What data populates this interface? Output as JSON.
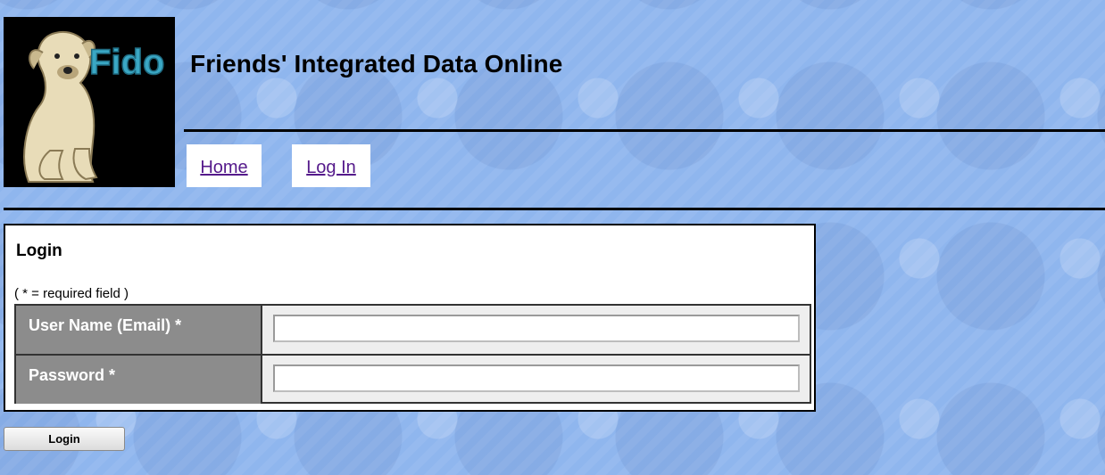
{
  "header": {
    "logo_text": "Fido",
    "site_title": "Friends' Integrated Data Online"
  },
  "nav": {
    "home_label": "Home",
    "login_label": "Log In"
  },
  "login_form": {
    "heading": "Login",
    "required_note": "( * = required field )",
    "username_label": "User Name (Email) *",
    "username_value": "",
    "password_label": "Password *",
    "password_value": "",
    "submit_label": "Login"
  },
  "colors": {
    "page_background": "#8fb6ee",
    "link": "#551a8b",
    "label_cell": "#8c8c8c"
  }
}
